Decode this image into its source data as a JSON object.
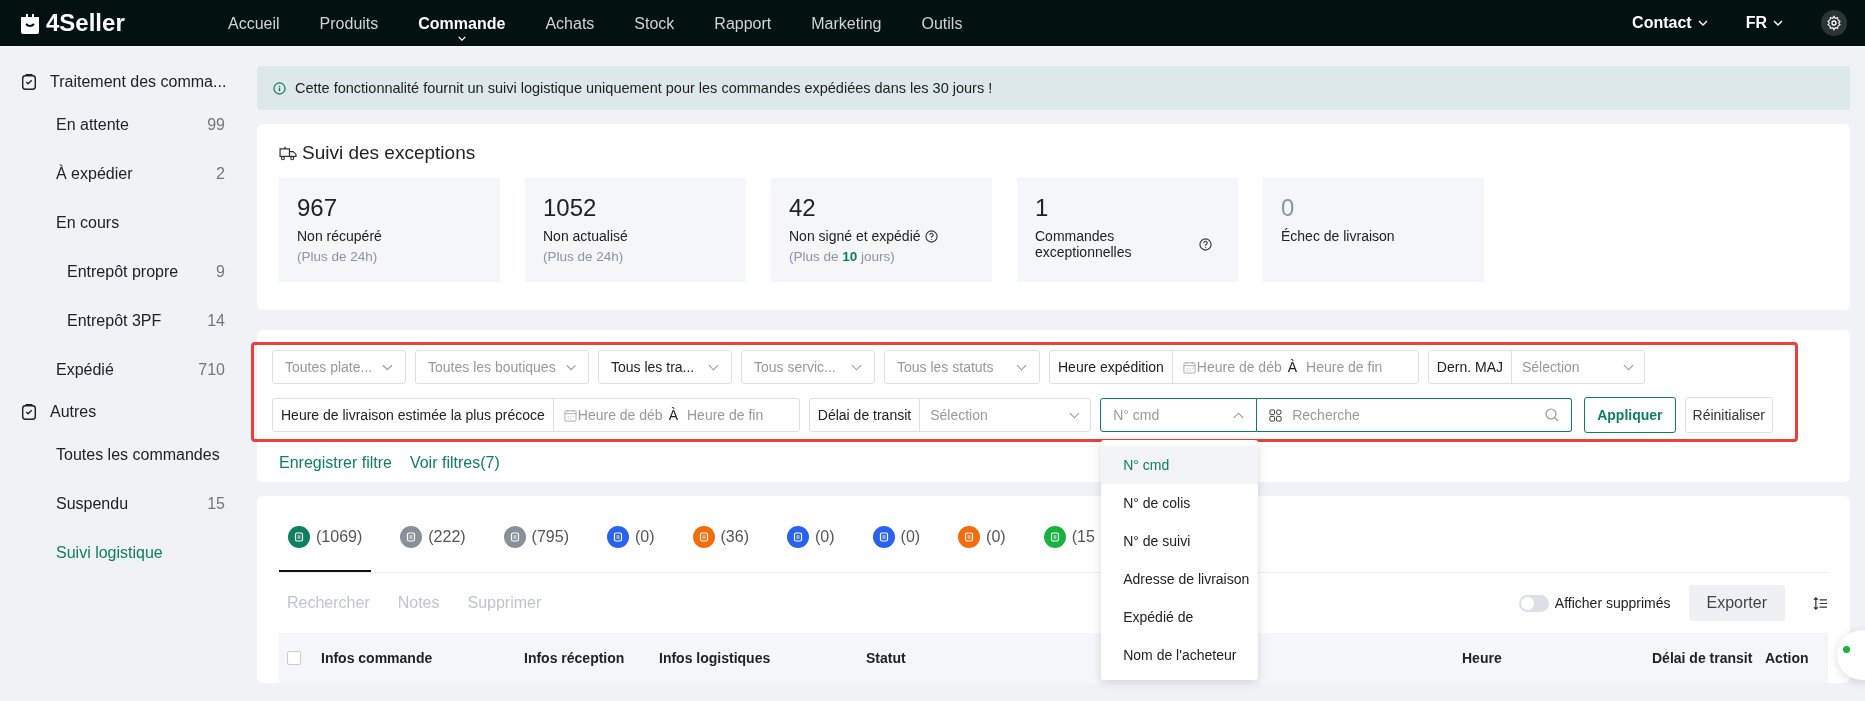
{
  "topbar": {
    "logo": "4Seller",
    "nav": [
      {
        "label": "Accueil",
        "selected": false
      },
      {
        "label": "Produits",
        "selected": false
      },
      {
        "label": "Commande",
        "selected": true
      },
      {
        "label": "Achats",
        "selected": false
      },
      {
        "label": "Stock",
        "selected": false
      },
      {
        "label": "Rapport",
        "selected": false
      },
      {
        "label": "Marketing",
        "selected": false
      },
      {
        "label": "Outils",
        "selected": false
      }
    ],
    "contact": "Contact",
    "language": "FR"
  },
  "sidebar": {
    "groups": [
      {
        "label": "Traitement des comma...",
        "items": [
          {
            "label": "En attente",
            "count": "99",
            "selected": false
          },
          {
            "label": "À expédier",
            "count": "2",
            "selected": false
          },
          {
            "label": "En cours",
            "selected": false,
            "children": [
              {
                "label": "Entrepôt propre",
                "count": "9",
                "selected": false
              },
              {
                "label": "Entrepôt 3PF",
                "count": "14",
                "selected": false
              }
            ]
          },
          {
            "label": "Expédié",
            "count": "710",
            "selected": false
          }
        ]
      },
      {
        "label": "Autres",
        "items": [
          {
            "label": "Toutes les commandes",
            "selected": false
          },
          {
            "label": "Suspendu",
            "count": "15",
            "selected": false
          },
          {
            "label": "Suivi logistique",
            "selected": true
          }
        ]
      }
    ]
  },
  "banner": "Cette fonctionnalité fournit un suivi logistique uniquement pour les commandes expédiées dans les 30 jours !",
  "exceptions": {
    "title": "Suivi des exceptions",
    "cards": [
      {
        "value": "967",
        "label": "Non récupéré",
        "note": "(Plus de 24h)",
        "help": false,
        "muted": false
      },
      {
        "value": "1052",
        "label": "Non actualisé",
        "note": "(Plus de 24h)",
        "help": false,
        "muted": false
      },
      {
        "value": "42",
        "label": "Non signé et expédié",
        "note": "(Plus de **10** jours)",
        "help": true,
        "muted": false
      },
      {
        "value": "1",
        "label": "Commandes exceptionnelles",
        "help": true,
        "muted": false
      },
      {
        "value": "0",
        "label": "Échec de livraison",
        "help": false,
        "muted": true
      }
    ]
  },
  "filters": {
    "row_1": [
      {
        "kind": "select",
        "placeholder": "Toutes plate..."
      },
      {
        "kind": "select",
        "placeholder": "Toutes les boutiques"
      },
      {
        "kind": "select",
        "value": "Tous les tra..."
      },
      {
        "kind": "select",
        "placeholder": "Tous servic..."
      },
      {
        "kind": "select",
        "placeholder": "Tous les statuts"
      },
      {
        "kind": "daterange",
        "label": "Heure expédition",
        "start": "Heure de déb",
        "separator": "À",
        "end": "Heure de fin"
      },
      {
        "kind": "labeled_select",
        "label": "Dern. MAJ",
        "placeholder": "Sélection"
      }
    ],
    "row_2": [
      {
        "kind": "daterange",
        "label": "Heure de livraison estimée la plus précoce",
        "start": "Heure de déb",
        "separator": "À",
        "end": "Heure de fin"
      },
      {
        "kind": "labeled_select",
        "label": "Délai de transit",
        "placeholder": "Sélection"
      },
      {
        "kind": "search",
        "field": "N° cmd",
        "expanded": true,
        "placeholder": "Recherche"
      }
    ],
    "apply": "Appliquer",
    "reset": "Réinitialiser",
    "save_filter": "Enregistrer filtre",
    "view_filters": "Voir filtres(7)",
    "search_options": [
      {
        "label": "N° cmd",
        "selected": true
      },
      {
        "label": "N° de colis",
        "selected": false
      },
      {
        "label": "N° de suivi",
        "selected": false
      },
      {
        "label": "Adresse de livraison",
        "selected": false
      },
      {
        "label": "Expédié de",
        "selected": false
      },
      {
        "label": "Nom de l'acheteur",
        "selected": false
      }
    ]
  },
  "status_tabs": [
    {
      "count": "(1069)",
      "color": "#0e7f5f",
      "selected": true
    },
    {
      "count": "(222)",
      "color": "#8a9099",
      "selected": false
    },
    {
      "count": "(795)",
      "color": "#8a9099",
      "selected": false
    },
    {
      "count": "(0)",
      "color": "#2a62f0",
      "selected": false
    },
    {
      "count": "(36)",
      "color": "#f56c0a",
      "selected": false
    },
    {
      "count": "(0)",
      "color": "#2a62f0",
      "selected": false
    },
    {
      "count": "(0)",
      "color": "#2a62f0",
      "selected": false
    },
    {
      "count": "(0)",
      "color": "#f56c0a",
      "selected": false
    },
    {
      "count": "(15",
      "color": "#17b340",
      "selected": false
    }
  ],
  "actions": [
    {
      "label": "Rechercher",
      "disabled": true
    },
    {
      "label": "Notes",
      "disabled": true
    },
    {
      "label": "Supprimer",
      "disabled": true
    }
  ],
  "show_deleted": {
    "label": "Afficher supprimés",
    "checked": false
  },
  "export": "Exporter",
  "table": {
    "select_all": {
      "checked": false
    },
    "columns": [
      "Infos commande",
      "Infos réception",
      "Infos logistiques",
      "Statut",
      "Heure",
      "Délai de transit",
      "Action"
    ]
  }
}
